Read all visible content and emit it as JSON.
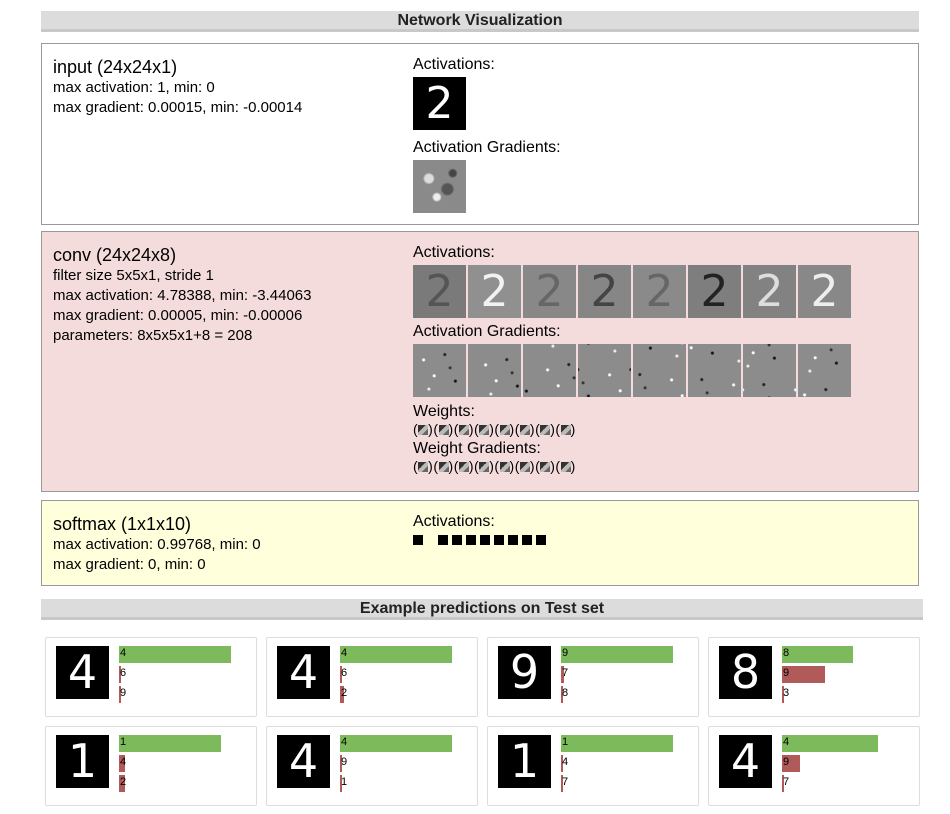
{
  "headers": {
    "network": "Network Visualization",
    "predictions": "Example predictions on Test set"
  },
  "layers": {
    "input": {
      "name": "input (24x24x1)",
      "line1": "max activation: 1, min: 0",
      "line2": "max gradient: 0.00015, min: -0.00014",
      "activations_label": "Activations:",
      "gradients_label": "Activation Gradients:",
      "digit": "2"
    },
    "conv": {
      "name": "conv (24x24x8)",
      "line1": "filter size 5x5x1, stride 1",
      "line2": "max activation: 4.78388, min: -3.44063",
      "line3": "max gradient: 0.00005, min: -0.00006",
      "line4": "parameters: 8x5x5x1+8 = 208",
      "activations_label": "Activations:",
      "gradients_label": "Activation Gradients:",
      "weights_label": "Weights:",
      "weight_gradients_label": "Weight Gradients:",
      "digit": "2"
    },
    "softmax": {
      "name": "softmax (1x1x10)",
      "line1": "max activation: 0.99768, min: 0",
      "line2": "max gradient: 0, min: 0",
      "activations_label": "Activations:"
    }
  },
  "colors": {
    "input_bg": "#ffffff",
    "conv_bg": "#f5dcdc",
    "softmax_bg": "#ffffdc",
    "correct_bar": "#7dba5b",
    "wrong_bar": "#b05a5a"
  },
  "predictions": [
    {
      "digit": "4",
      "rows": [
        {
          "label": "4",
          "value": 1.0,
          "correct": true
        },
        {
          "label": "6",
          "value": 0.02,
          "correct": false
        },
        {
          "label": "9",
          "value": 0.02,
          "correct": false
        }
      ]
    },
    {
      "digit": "4",
      "rows": [
        {
          "label": "4",
          "value": 1.0,
          "correct": true
        },
        {
          "label": "6",
          "value": 0.02,
          "correct": false
        },
        {
          "label": "2",
          "value": 0.04,
          "correct": false
        }
      ]
    },
    {
      "digit": "9",
      "rows": [
        {
          "label": "9",
          "value": 1.0,
          "correct": true
        },
        {
          "label": "7",
          "value": 0.03,
          "correct": false
        },
        {
          "label": "8",
          "value": 0.02,
          "correct": false
        }
      ]
    },
    {
      "digit": "8",
      "rows": [
        {
          "label": "8",
          "value": 0.63,
          "correct": true
        },
        {
          "label": "9",
          "value": 0.38,
          "correct": false
        },
        {
          "label": "3",
          "value": 0.02,
          "correct": false
        }
      ]
    },
    {
      "digit": "1",
      "rows": [
        {
          "label": "1",
          "value": 0.91,
          "correct": true
        },
        {
          "label": "4",
          "value": 0.05,
          "correct": false
        },
        {
          "label": "2",
          "value": 0.05,
          "correct": false
        }
      ]
    },
    {
      "digit": "4",
      "rows": [
        {
          "label": "4",
          "value": 1.0,
          "correct": true
        },
        {
          "label": "9",
          "value": 0.02,
          "correct": false
        },
        {
          "label": "1",
          "value": 0.02,
          "correct": false
        }
      ]
    },
    {
      "digit": "1",
      "rows": [
        {
          "label": "1",
          "value": 1.0,
          "correct": true
        },
        {
          "label": "4",
          "value": 0.02,
          "correct": false
        },
        {
          "label": "7",
          "value": 0.02,
          "correct": false
        }
      ]
    },
    {
      "digit": "4",
      "rows": [
        {
          "label": "4",
          "value": 0.86,
          "correct": true
        },
        {
          "label": "9",
          "value": 0.16,
          "correct": false
        },
        {
          "label": "7",
          "value": 0.02,
          "correct": false
        }
      ]
    }
  ]
}
